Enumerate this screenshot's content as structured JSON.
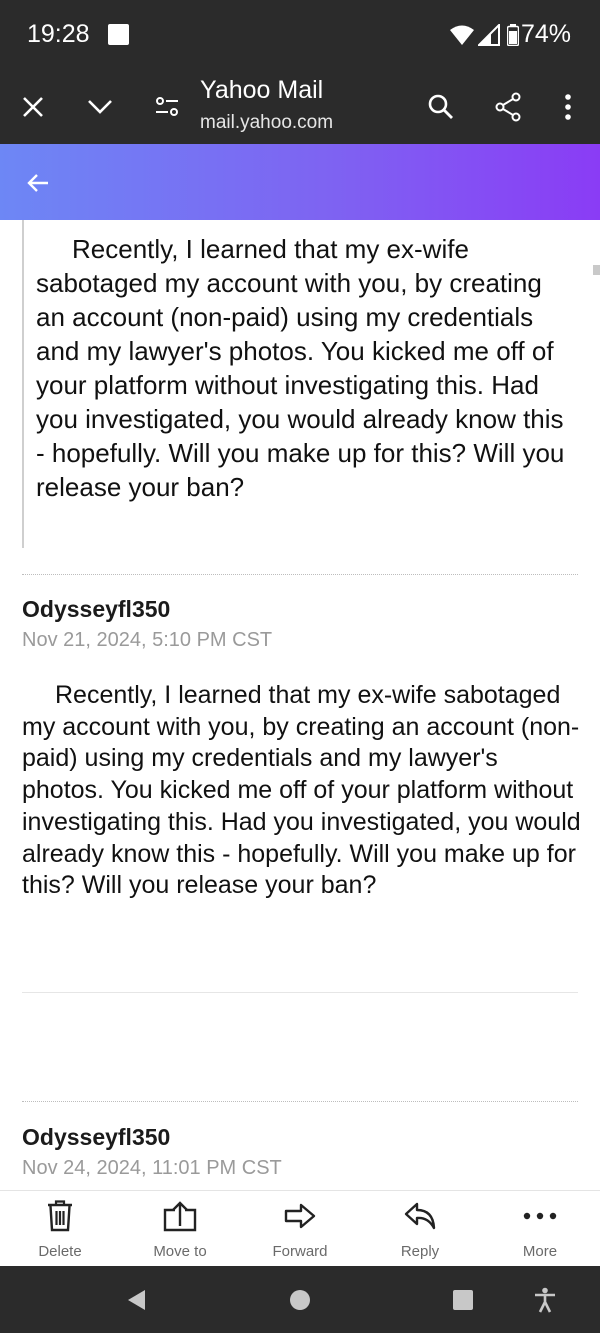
{
  "status": {
    "time": "19:28",
    "battery": "74%"
  },
  "browser": {
    "title": "Yahoo Mail",
    "url": "mail.yahoo.com"
  },
  "quoted_text": "Recently, I learned that my ex-wife sabotaged my account with you, by creating an account (non-paid) using my credentials and my lawyer's photos. You kicked me off of your platform without investigating this. Had you investigated, you would already know this - hopefully. Will you make up for this? Will you release your ban?",
  "messages": [
    {
      "sender": "Odysseyfl350",
      "date": "Nov 21, 2024, 5:10 PM CST",
      "body": "Recently, I learned that my ex-wife sabotaged my account with you, by creating an account (non-paid) using my credentials and my lawyer's photos. You kicked me off of your platform without investigating this. Had you investigated, you would already know this - hopefully. Will you make up for this? Will you release your ban?"
    },
    {
      "sender": "Odysseyfl350",
      "date": "Nov 24, 2024, 11:01 PM CST"
    }
  ],
  "actions": [
    {
      "label": "Delete",
      "icon": "trash-icon"
    },
    {
      "label": "Move to",
      "icon": "move-to-icon"
    },
    {
      "label": "Forward",
      "icon": "forward-arrow-icon"
    },
    {
      "label": "Reply",
      "icon": "reply-arrow-icon"
    },
    {
      "label": "More",
      "icon": "more-dots-icon"
    }
  ],
  "colors": {
    "status_bg": "#2b2b2b",
    "header_gradient_start": "#6d87f5",
    "header_gradient_end": "#8a3cf5",
    "muted_text": "#9a9a9a"
  }
}
